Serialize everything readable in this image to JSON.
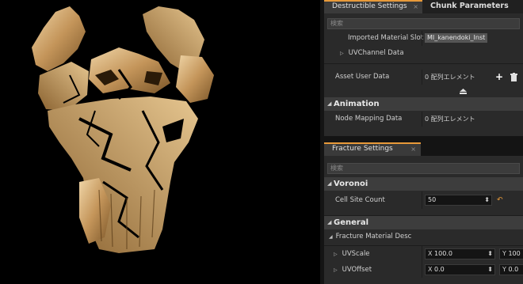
{
  "destructible_panel": {
    "tabs": [
      {
        "label": "Destructible Settings",
        "close": "×"
      },
      {
        "label": "Chunk Parameters"
      }
    ],
    "search_placeholder": "検索",
    "imported_material_slot": {
      "label": "Imported Material Slot",
      "value": "MI_kanendoki_Inst"
    },
    "uv_channel_data": {
      "label": "UVChannel Data"
    },
    "asset_user_data": {
      "label": "Asset User Data",
      "value": "0 配列エレメント"
    },
    "animation": {
      "title": "Animation"
    },
    "node_mapping_data": {
      "label": "Node Mapping Data",
      "value": "0 配列エレメント"
    }
  },
  "fracture_panel": {
    "tab": {
      "label": "Fracture Settings",
      "close": "×"
    },
    "search_placeholder": "検索",
    "voronoi": {
      "title": "Voronoi"
    },
    "cell_site_count": {
      "label": "Cell Site Count",
      "value": "50"
    },
    "general": {
      "title": "General"
    },
    "fracture_material_desc": {
      "label": "Fracture Material Desc"
    },
    "uv_scale": {
      "label": "UVScale",
      "x_label": "X",
      "x_value": "100.0",
      "y_label": "Y",
      "y_value": "100"
    },
    "uv_offset": {
      "label": "UVOffset",
      "x_label": "X",
      "x_value": "0.0",
      "y_label": "Y",
      "y_value": "0.0"
    }
  },
  "icons": [
    "plus-icon",
    "trash-icon",
    "collapse-arrow-icon",
    "reset-arrow-icon",
    "expand-triangle-icon",
    "spin-arrows-icon"
  ],
  "colors": {
    "active_tab_accent": "#e89a3a",
    "panel_bg": "#2a2a2a",
    "mesh_gold": "#c89a5a"
  }
}
